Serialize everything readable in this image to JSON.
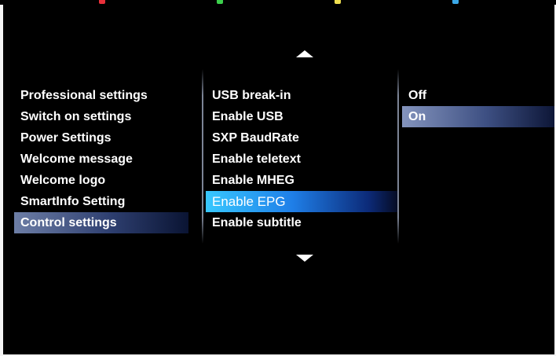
{
  "color_keys": [
    {
      "name": "red",
      "color": "#e8303a"
    },
    {
      "name": "green",
      "color": "#3ccf4c"
    },
    {
      "name": "yellow",
      "color": "#f0e050"
    },
    {
      "name": "blue",
      "color": "#3aa8e8"
    }
  ],
  "main_menu": {
    "items": [
      {
        "label": "Professional settings"
      },
      {
        "label": "Switch on settings"
      },
      {
        "label": "Power Settings"
      },
      {
        "label": "Welcome message"
      },
      {
        "label": "Welcome logo"
      },
      {
        "label": "SmartInfo Setting"
      },
      {
        "label": "Control settings"
      }
    ],
    "selected_index": 6
  },
  "sub_menu": {
    "items": [
      {
        "label": "USB break-in"
      },
      {
        "label": "Enable USB"
      },
      {
        "label": "SXP BaudRate"
      },
      {
        "label": "Enable teletext"
      },
      {
        "label": "Enable MHEG"
      },
      {
        "label": "Enable EPG"
      },
      {
        "label": "Enable subtitle"
      }
    ],
    "focused_index": 5
  },
  "value_menu": {
    "items": [
      {
        "label": "Off"
      },
      {
        "label": "On"
      }
    ],
    "selected_index": 1
  },
  "icons": {
    "scroll_up": "caret-up-icon",
    "scroll_down": "caret-down-icon"
  },
  "colors": {
    "focus_highlight": "#1f7fe8",
    "selection_highlight": "#3d4f82",
    "background": "#000000"
  }
}
